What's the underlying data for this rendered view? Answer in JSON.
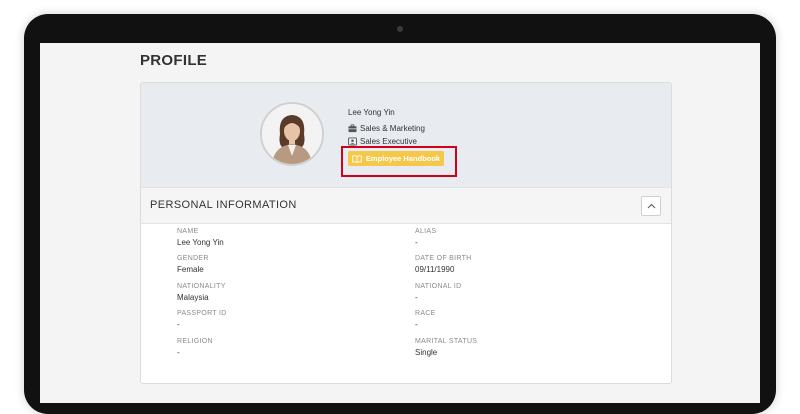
{
  "page": {
    "title": "PROFILE"
  },
  "profile": {
    "name": "Lee Yong Yin",
    "department": "Sales & Marketing",
    "job_title": "Sales Executive",
    "handbook_label": "Employee Handbook",
    "handbook_color": "#f5c84a",
    "highlight_color": "#d0021b"
  },
  "personal_info": {
    "section_title": "PERSONAL INFORMATION",
    "fields": [
      {
        "label": "NAME",
        "value": "Lee Yong Yin"
      },
      {
        "label": "ALIAS",
        "value": "-"
      },
      {
        "label": "GENDER",
        "value": "Female"
      },
      {
        "label": "DATE OF BIRTH",
        "value": "09/11/1990"
      },
      {
        "label": "NATIONALITY",
        "value": "Malaysia"
      },
      {
        "label": "NATIONAL ID",
        "value": "-"
      },
      {
        "label": "PASSPORT ID",
        "value": "-"
      },
      {
        "label": "RACE",
        "value": "-"
      },
      {
        "label": "RELIGION",
        "value": "-"
      },
      {
        "label": "MARITAL STATUS",
        "value": "Single"
      }
    ]
  },
  "icons": {
    "department": "briefcase-icon",
    "job_title": "id-badge-icon",
    "handbook": "book-open-icon",
    "collapse": "chevron-up-icon"
  }
}
